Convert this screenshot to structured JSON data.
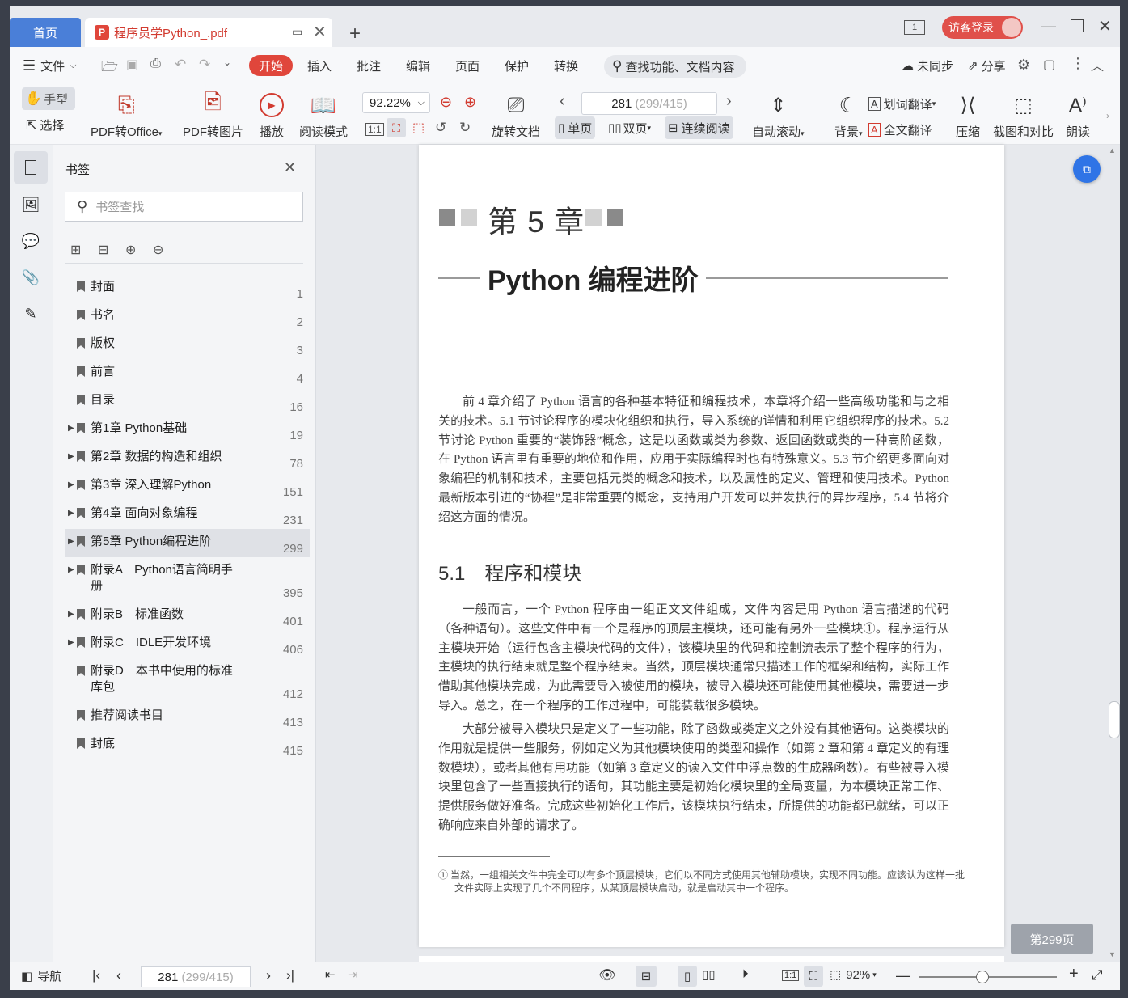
{
  "tabs": {
    "home": "首页",
    "doc_title": "程序员学Python_.pdf"
  },
  "header": {
    "login": "访客登录"
  },
  "menu": {
    "file": "文件",
    "items": [
      "开始",
      "插入",
      "批注",
      "编辑",
      "页面",
      "保护",
      "转换"
    ],
    "search_placeholder": "查找功能、文档内容",
    "sync": "未同步",
    "share": "分享"
  },
  "toolbar": {
    "hand": "手型",
    "select": "选择",
    "pdf_to_office": "PDF转Office",
    "pdf_to_image": "PDF转图片",
    "play": "播放",
    "read_mode": "阅读模式",
    "zoom": "92.22%",
    "rotate": "旋转文档",
    "page_current": "281",
    "page_total": "(299/415)",
    "single": "单页",
    "double": "双页",
    "continuous": "连续阅读",
    "autoscroll": "自动滚动",
    "background": "背景",
    "word_translate": "划词翻译",
    "full_translate": "全文翻译",
    "compress": "压缩",
    "screenshot_compare": "截图和对比",
    "read_aloud": "朗读"
  },
  "bookmarks": {
    "title": "书签",
    "search_placeholder": "书签查找",
    "items": [
      {
        "label": "封面",
        "page": "1"
      },
      {
        "label": "书名",
        "page": "2"
      },
      {
        "label": "版权",
        "page": "3"
      },
      {
        "label": "前言",
        "page": "4"
      },
      {
        "label": "目录",
        "page": "16"
      },
      {
        "label": "第1章 Python基础",
        "page": "19"
      },
      {
        "label": "第2章 数据的构造和组织",
        "page": "78"
      },
      {
        "label": "第3章 深入理解Python",
        "page": "151"
      },
      {
        "label": "第4章 面向对象编程",
        "page": "231"
      },
      {
        "label": "第5章 Python编程进阶",
        "page": "299"
      },
      {
        "label": "附录A　Python语言简明手册",
        "page": "395"
      },
      {
        "label": "附录B　标准函数",
        "page": "401"
      },
      {
        "label": "附录C　IDLE开发环境",
        "page": "406"
      },
      {
        "label": "附录D　本书中使用的标准库包",
        "page": "412"
      },
      {
        "label": "推荐阅读书目",
        "page": "413"
      },
      {
        "label": "封底",
        "page": "415"
      }
    ]
  },
  "document": {
    "chapter": "第 5 章",
    "chapter_title": "Python 编程进阶",
    "intro": "前 4 章介绍了 Python 语言的各种基本特征和编程技术，本章将介绍一些高级功能和与之相关的技术。5.1 节讨论程序的模块化组织和执行，导入系统的详情和利用它组织程序的技术。5.2 节讨论 Python 重要的“装饰器”概念，这是以函数或类为参数、返回函数或类的一种高阶函数，在 Python 语言里有重要的地位和作用，应用于实际编程时也有特殊意义。5.3 节介绍更多面向对象编程的机制和技术，主要包括元类的概念和技术，以及属性的定义、管理和使用技术。Python 最新版本引进的“协程”是非常重要的概念，支持用户开发可以并发执行的异步程序，5.4 节将介绍这方面的情况。",
    "section": "5.1　程序和模块",
    "p1": "一般而言，一个 Python 程序由一组正文文件组成，文件内容是用 Python 语言描述的代码（各种语句）。这些文件中有一个是程序的顶层主模块，还可能有另外一些模块①。程序运行从主模块开始（运行包含主模块代码的文件），该模块里的代码和控制流表示了整个程序的行为，主模块的执行结束就是整个程序结束。当然，顶层模块通常只描述工作的框架和结构，实际工作借助其他模块完成，为此需要导入被使用的模块，被导入模块还可能使用其他模块，需要进一步导入。总之，在一个程序的工作过程中，可能装载很多模块。",
    "p2": "大部分被导入模块只是定义了一些功能，除了函数或类定义之外没有其他语句。这类模块的作用就是提供一些服务，例如定义为其他模块使用的类型和操作（如第 2 章和第 4 章定义的有理数模块），或者其他有用功能（如第 3 章定义的读入文件中浮点数的生成器函数）。有些被导入模块里包含了一些直接执行的语句，其功能主要是初始化模块里的全局变量，为本模块正常工作、提供服务做好准备。完成这些初始化工作后，该模块执行结束，所提供的功能都已就绪，可以正确响应来自外部的请求了。",
    "footnote": "① 当然，一组相关文件中完全可以有多个顶层模块，它们以不同方式使用其他辅助模块，实现不同功能。应该认为这样一批文件实际上实现了几个不同程序，从某顶层模块启动，就是启动其中一个程序。",
    "page_badge": "第299页"
  },
  "status": {
    "nav": "导航",
    "page_current": "281",
    "page_total": "(299/415)",
    "zoom": "92%"
  },
  "colors": {
    "accent_red": "#e0463b",
    "home_tab": "#4a7fd8",
    "fab": "#2f74e6"
  }
}
